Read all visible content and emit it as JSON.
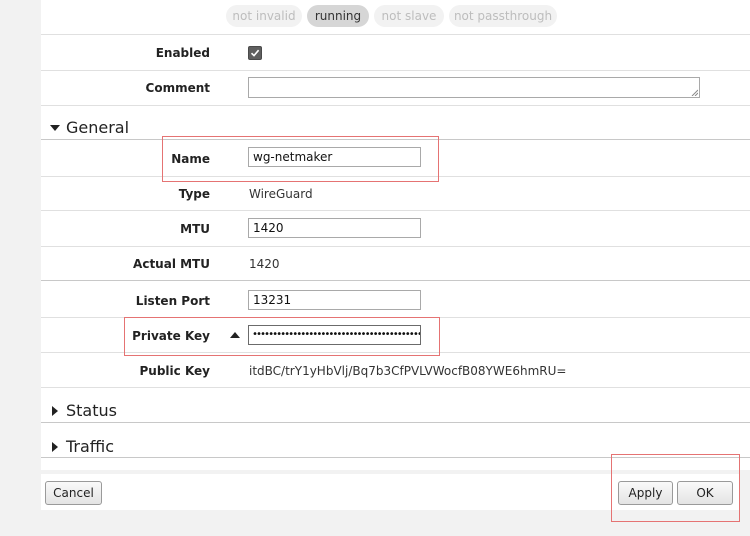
{
  "status_pills": [
    "not invalid",
    "running",
    "not slave",
    "not passthrough"
  ],
  "fields": {
    "enabled_label": "Enabled",
    "enabled_checked": true,
    "comment_label": "Comment",
    "comment_value": ""
  },
  "general": {
    "title": "General",
    "name_label": "Name",
    "name_value": "wg-netmaker",
    "type_label": "Type",
    "type_value": "WireGuard",
    "mtu_label": "MTU",
    "mtu_value": "1420",
    "actual_mtu_label": "Actual MTU",
    "actual_mtu_value": "1420",
    "listen_port_label": "Listen Port",
    "listen_port_value": "13231",
    "private_key_label": "Private Key",
    "private_key_mask": "••••••••••••••••••••••••••••••••••••••••••••",
    "public_key_label": "Public Key",
    "public_key_value": "itdBC/trY1yHbVlj/Bq7b3CfPVLVWocfB08YWE6hmRU="
  },
  "sections": {
    "status": "Status",
    "traffic": "Traffic"
  },
  "buttons": {
    "cancel": "Cancel",
    "apply": "Apply",
    "ok": "OK"
  },
  "colors": {
    "highlight": "#e57373",
    "active_pill": "#d6d6d6"
  }
}
